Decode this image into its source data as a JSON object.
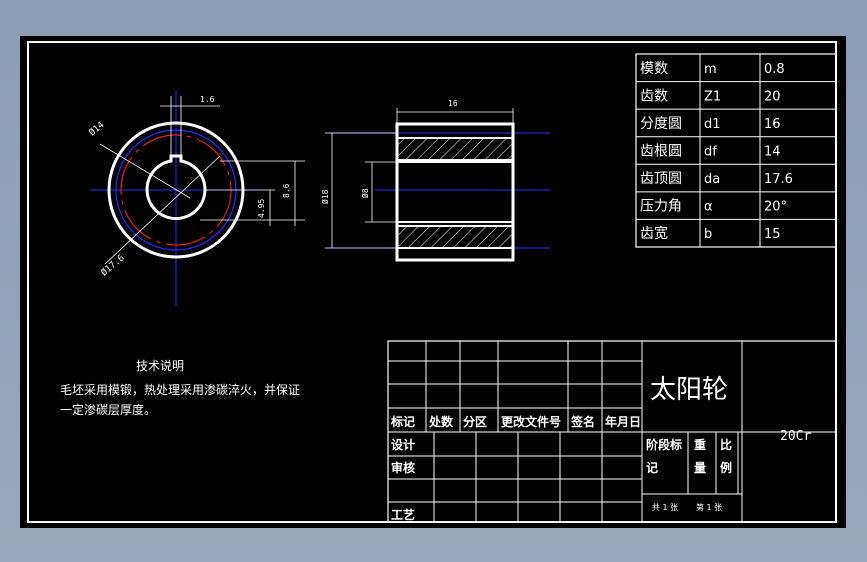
{
  "param_table": {
    "rows": [
      {
        "label": "模数",
        "symbol": "m",
        "value": "0.8"
      },
      {
        "label": "齿数",
        "symbol": "Z1",
        "value": "20"
      },
      {
        "label": "分度圆",
        "symbol": "d1",
        "value": "16"
      },
      {
        "label": "齿根圆",
        "symbol": "df",
        "value": "14"
      },
      {
        "label": "齿顶圆",
        "symbol": "da",
        "value": "17.6"
      },
      {
        "label": "压力角",
        "symbol": "α",
        "value": "20°"
      },
      {
        "label": "齿宽",
        "symbol": "b",
        "value": "15"
      }
    ]
  },
  "dimensions": {
    "key_width": "1.6",
    "bore_dia": "Ø14",
    "outer_dia": "Ø17.6",
    "keyway_depth": "4.95",
    "bore_height": "8.6",
    "width": "16",
    "hub_dia": "Ø18",
    "inner_dia": "Ø8"
  },
  "tech_notes": {
    "title": "技术说明",
    "line1": "毛坯采用模锻，热处理采用渗碳淬火，并保证",
    "line2": "一定渗碳层厚度。"
  },
  "title_block": {
    "part_name": "太阳轮",
    "material": "20Cr",
    "rev_headers": [
      "标记",
      "处数",
      "分区",
      "更改文件号",
      "签名",
      "年月日"
    ],
    "design": "设计",
    "review": "审核",
    "process": "工艺",
    "stage_mark": "阶段标",
    "mark": "记",
    "weight": "重",
    "weight2": "量",
    "scale": "比",
    "scale2": "例",
    "sheets_total": "共 1 张",
    "sheet_no": "第 1 张"
  },
  "colors": {
    "background": "#000000",
    "line": "#ffffff",
    "center": "#2a2aff",
    "pitch": "#e02020",
    "dim": "#ffffff"
  }
}
